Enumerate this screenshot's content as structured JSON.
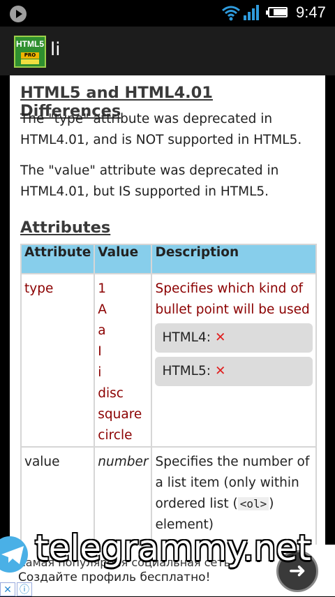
{
  "status_bar": {
    "time": "9:47",
    "icons": [
      "play-icon",
      "wifi-icon",
      "signal-icon",
      "battery-icon"
    ]
  },
  "app_bar": {
    "logo_text": "HTML5",
    "logo_badge": "PRO",
    "title": "li"
  },
  "content": {
    "differences_heading": "HTML5 and HTML4.01 Differences",
    "para_type": "The \"type\" attribute was deprecated in HTML4.01, and is NOT supported in HTML5.",
    "para_value": "The \"value\" attribute was deprecated in HTML4.01, but IS supported in HTML5.",
    "attributes_heading": "Attributes",
    "table": {
      "headers": [
        "Attribute",
        "Value",
        "Description"
      ],
      "rows": [
        {
          "attribute": "type",
          "values": [
            "1",
            "A",
            "a",
            "I",
            "i",
            "disc",
            "square",
            "circle"
          ],
          "description": "Specifies which kind of bullet point will be used",
          "support": [
            {
              "label": "HTML4:",
              "icon": "x-icon"
            },
            {
              "label": "HTML5:",
              "icon": "x-icon"
            }
          ]
        },
        {
          "attribute": "value",
          "value": "number",
          "description_before": "Specifies the number of a list item (only within ordered list (",
          "code": "<ol>",
          "description_after": ") element)"
        }
      ]
    }
  },
  "ad": {
    "line1": "самая популярная социальная сеть",
    "line2": "Создайте профиль бесплатно!",
    "watermark": "telegrammy.net",
    "close_icon": "close-icon",
    "info_icon": "info-icon"
  },
  "colors": {
    "header_bg": "#87ceeb",
    "value_text": "#8b0000",
    "appbar_bg": "#1c1c1c"
  }
}
